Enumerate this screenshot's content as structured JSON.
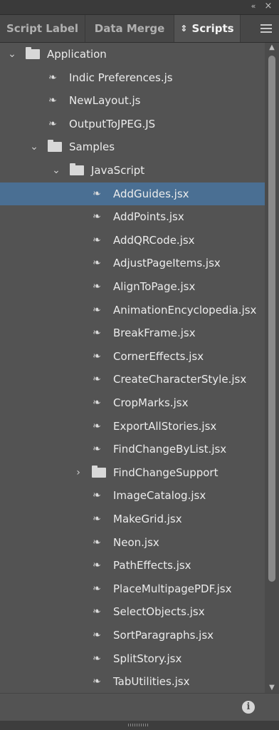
{
  "tabs": [
    {
      "label": "Script Label",
      "active": false
    },
    {
      "label": "Data Merge",
      "active": false
    },
    {
      "label": "Scripts",
      "active": true
    }
  ],
  "icons": {
    "collapse": "«",
    "close": "×",
    "sort": "⇕",
    "chevron_open": "⌄",
    "chevron_closed": "›",
    "info": "i"
  },
  "tree": [
    {
      "label": "Application",
      "type": "folder",
      "level": 0,
      "expanded": true,
      "selected": false
    },
    {
      "label": "Indic Preferences.js",
      "type": "script",
      "level": 1,
      "selected": false
    },
    {
      "label": "NewLayout.js",
      "type": "script",
      "level": 1,
      "selected": false
    },
    {
      "label": "OutputToJPEG.JS",
      "type": "script",
      "level": 1,
      "selected": false
    },
    {
      "label": "Samples",
      "type": "folder",
      "level": 1,
      "expanded": true,
      "selected": false
    },
    {
      "label": "JavaScript",
      "type": "folder",
      "level": 2,
      "expanded": true,
      "selected": false
    },
    {
      "label": "AddGuides.jsx",
      "type": "script",
      "level": 3,
      "selected": true
    },
    {
      "label": "AddPoints.jsx",
      "type": "script",
      "level": 3,
      "selected": false
    },
    {
      "label": "AddQRCode.jsx",
      "type": "script",
      "level": 3,
      "selected": false
    },
    {
      "label": "AdjustPageItems.jsx",
      "type": "script",
      "level": 3,
      "selected": false
    },
    {
      "label": "AlignToPage.jsx",
      "type": "script",
      "level": 3,
      "selected": false
    },
    {
      "label": "AnimationEncyclopedia.jsx",
      "type": "script",
      "level": 3,
      "selected": false
    },
    {
      "label": "BreakFrame.jsx",
      "type": "script",
      "level": 3,
      "selected": false
    },
    {
      "label": "CornerEffects.jsx",
      "type": "script",
      "level": 3,
      "selected": false
    },
    {
      "label": "CreateCharacterStyle.jsx",
      "type": "script",
      "level": 3,
      "selected": false
    },
    {
      "label": "CropMarks.jsx",
      "type": "script",
      "level": 3,
      "selected": false
    },
    {
      "label": "ExportAllStories.jsx",
      "type": "script",
      "level": 3,
      "selected": false
    },
    {
      "label": "FindChangeByList.jsx",
      "type": "script",
      "level": 3,
      "selected": false
    },
    {
      "label": "FindChangeSupport",
      "type": "folder",
      "level": 3,
      "expanded": false,
      "selected": false
    },
    {
      "label": "ImageCatalog.jsx",
      "type": "script",
      "level": 3,
      "selected": false
    },
    {
      "label": "MakeGrid.jsx",
      "type": "script",
      "level": 3,
      "selected": false
    },
    {
      "label": "Neon.jsx",
      "type": "script",
      "level": 3,
      "selected": false
    },
    {
      "label": "PathEffects.jsx",
      "type": "script",
      "level": 3,
      "selected": false
    },
    {
      "label": "PlaceMultipagePDF.jsx",
      "type": "script",
      "level": 3,
      "selected": false
    },
    {
      "label": "SelectObjects.jsx",
      "type": "script",
      "level": 3,
      "selected": false
    },
    {
      "label": "SortParagraphs.jsx",
      "type": "script",
      "level": 3,
      "selected": false
    },
    {
      "label": "SplitStory.jsx",
      "type": "script",
      "level": 3,
      "selected": false
    },
    {
      "label": "TabUtilities.jsx",
      "type": "script",
      "level": 3,
      "selected": false
    }
  ]
}
